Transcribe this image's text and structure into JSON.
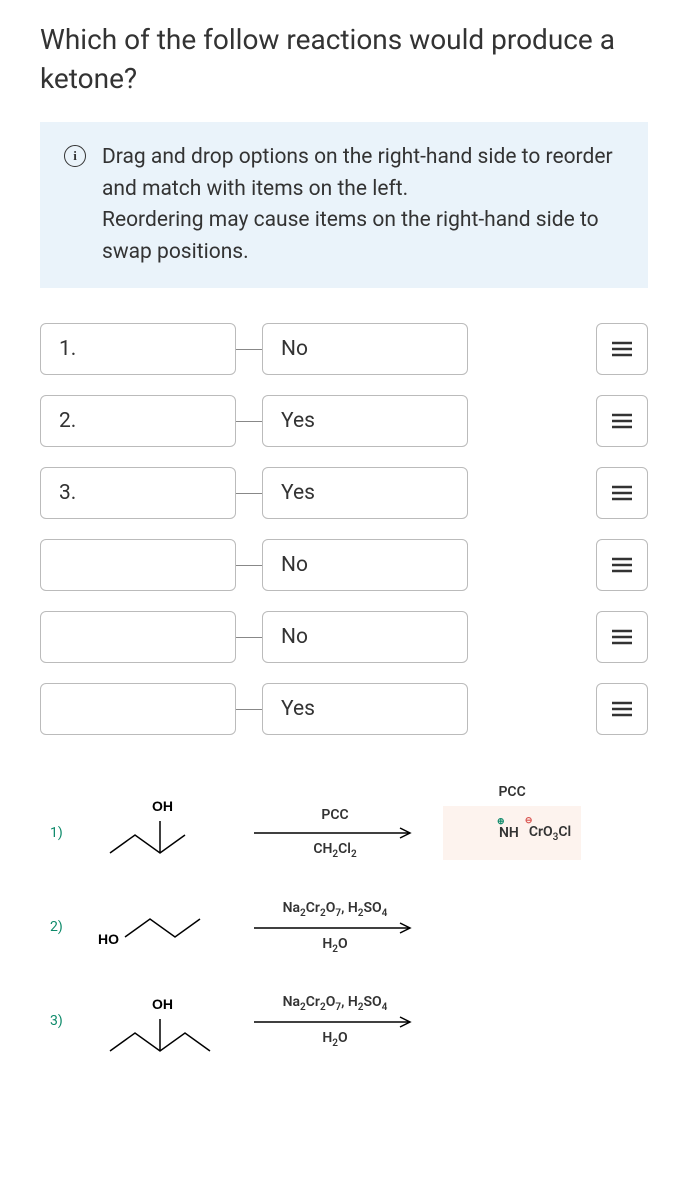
{
  "question": "Which of the follow reactions would produce a ketone?",
  "instructions": "Drag and drop options on the right-hand side to reorder and match with items on the left.\nReordering may cause items on the right-hand side to swap positions.",
  "info_icon_label": "i",
  "left_items": [
    "1.",
    "2.",
    "3.",
    "",
    "",
    ""
  ],
  "right_items": [
    "No",
    "Yes",
    "Yes",
    "No",
    "No",
    "Yes"
  ],
  "reactions": [
    {
      "num": "1)",
      "start_label_top": "OH",
      "arrow_top": "PCC",
      "arrow_bottom": "CH₂Cl₂",
      "product_label_top": "PCC",
      "product_nh": "NH",
      "product_anion": "CrO₃Cl"
    },
    {
      "num": "2)",
      "start_label": "HO",
      "arrow_top": "Na₂Cr₂O₇, H₂SO₄",
      "arrow_bottom": "H₂O"
    },
    {
      "num": "3)",
      "start_label_top": "OH",
      "arrow_top": "Na₂Cr₂O₇, H₂SO₄",
      "arrow_bottom": "H₂O"
    }
  ]
}
